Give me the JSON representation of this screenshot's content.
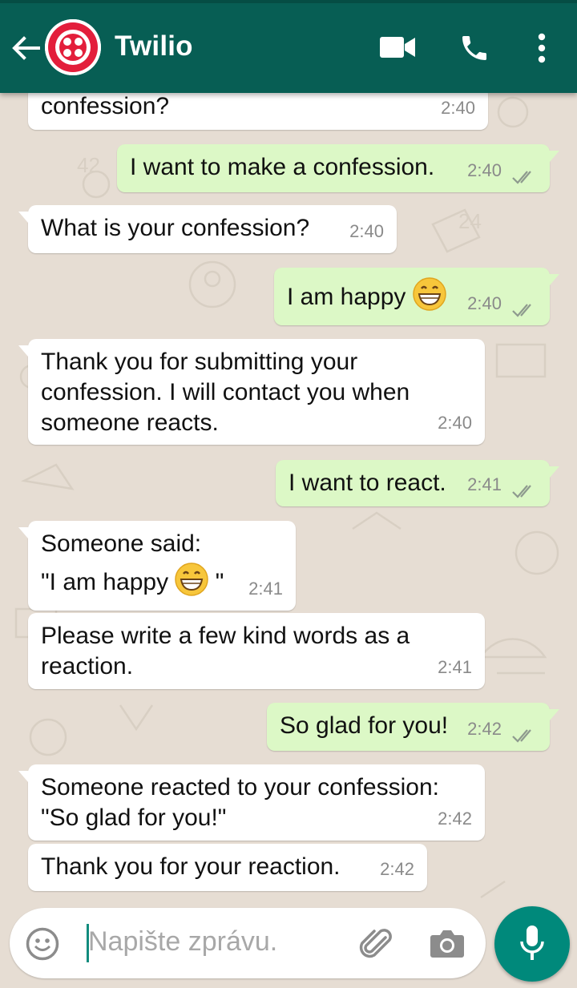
{
  "header": {
    "title": "Twilio",
    "back_icon": "arrow-left-icon",
    "avatar_icon": "twilio-logo-icon",
    "video_icon": "video-camera-icon",
    "call_icon": "phone-icon",
    "menu_icon": "more-vertical-icon",
    "color": "#075e54"
  },
  "messages": [
    {
      "dir": "in",
      "text": "confession?",
      "time": "2:40"
    },
    {
      "dir": "out",
      "text": "I want to make a confession.",
      "time": "2:40"
    },
    {
      "dir": "in",
      "text": "What is your confession?",
      "time": "2:40"
    },
    {
      "dir": "out",
      "text": "I am happy",
      "emoji": "grinning-face-emoji",
      "time": "2:40"
    },
    {
      "dir": "in",
      "text": "Thank you for submitting your\nconfession. I will contact you when\nsomeone reacts.",
      "time": "2:40"
    },
    {
      "dir": "out",
      "text": "I want to react.",
      "time": "2:41"
    },
    {
      "dir": "in",
      "text_line1": "Someone said:",
      "text_line2a": "\"I am happy",
      "text_line2b": "\"",
      "emoji": "grinning-face-emoji",
      "time": "2:41"
    },
    {
      "dir": "in",
      "text": "Please write a few kind words as a\nreaction.",
      "time": "2:41"
    },
    {
      "dir": "out",
      "text": "So glad for you!",
      "time": "2:42"
    },
    {
      "dir": "in",
      "text": "Someone reacted to your confession:\n\"So glad for you!\"",
      "time": "2:42"
    },
    {
      "dir": "in",
      "text": "Thank you for your reaction.",
      "time": "2:42"
    }
  ],
  "input": {
    "placeholder": "Napište zprávu.",
    "emoji_icon": "smiley-icon",
    "attach_icon": "paperclip-icon",
    "camera_icon": "camera-icon",
    "mic_icon": "microphone-icon"
  },
  "colors": {
    "outgoing_bubble": "#dcf8c6",
    "incoming_bubble": "#ffffff",
    "mic_button": "#00897b"
  }
}
